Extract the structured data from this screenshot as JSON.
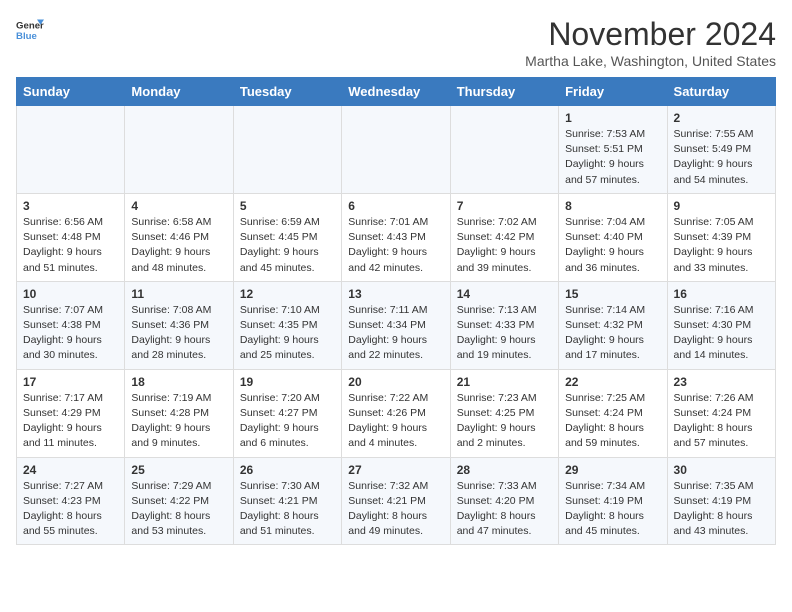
{
  "logo": {
    "line1": "General",
    "line2": "Blue"
  },
  "title": "November 2024",
  "subtitle": "Martha Lake, Washington, United States",
  "days_of_week": [
    "Sunday",
    "Monday",
    "Tuesday",
    "Wednesday",
    "Thursday",
    "Friday",
    "Saturday"
  ],
  "weeks": [
    [
      {
        "day": "",
        "text": ""
      },
      {
        "day": "",
        "text": ""
      },
      {
        "day": "",
        "text": ""
      },
      {
        "day": "",
        "text": ""
      },
      {
        "day": "",
        "text": ""
      },
      {
        "day": "1",
        "text": "Sunrise: 7:53 AM\nSunset: 5:51 PM\nDaylight: 9 hours and 57 minutes."
      },
      {
        "day": "2",
        "text": "Sunrise: 7:55 AM\nSunset: 5:49 PM\nDaylight: 9 hours and 54 minutes."
      }
    ],
    [
      {
        "day": "3",
        "text": "Sunrise: 6:56 AM\nSunset: 4:48 PM\nDaylight: 9 hours and 51 minutes."
      },
      {
        "day": "4",
        "text": "Sunrise: 6:58 AM\nSunset: 4:46 PM\nDaylight: 9 hours and 48 minutes."
      },
      {
        "day": "5",
        "text": "Sunrise: 6:59 AM\nSunset: 4:45 PM\nDaylight: 9 hours and 45 minutes."
      },
      {
        "day": "6",
        "text": "Sunrise: 7:01 AM\nSunset: 4:43 PM\nDaylight: 9 hours and 42 minutes."
      },
      {
        "day": "7",
        "text": "Sunrise: 7:02 AM\nSunset: 4:42 PM\nDaylight: 9 hours and 39 minutes."
      },
      {
        "day": "8",
        "text": "Sunrise: 7:04 AM\nSunset: 4:40 PM\nDaylight: 9 hours and 36 minutes."
      },
      {
        "day": "9",
        "text": "Sunrise: 7:05 AM\nSunset: 4:39 PM\nDaylight: 9 hours and 33 minutes."
      }
    ],
    [
      {
        "day": "10",
        "text": "Sunrise: 7:07 AM\nSunset: 4:38 PM\nDaylight: 9 hours and 30 minutes."
      },
      {
        "day": "11",
        "text": "Sunrise: 7:08 AM\nSunset: 4:36 PM\nDaylight: 9 hours and 28 minutes."
      },
      {
        "day": "12",
        "text": "Sunrise: 7:10 AM\nSunset: 4:35 PM\nDaylight: 9 hours and 25 minutes."
      },
      {
        "day": "13",
        "text": "Sunrise: 7:11 AM\nSunset: 4:34 PM\nDaylight: 9 hours and 22 minutes."
      },
      {
        "day": "14",
        "text": "Sunrise: 7:13 AM\nSunset: 4:33 PM\nDaylight: 9 hours and 19 minutes."
      },
      {
        "day": "15",
        "text": "Sunrise: 7:14 AM\nSunset: 4:32 PM\nDaylight: 9 hours and 17 minutes."
      },
      {
        "day": "16",
        "text": "Sunrise: 7:16 AM\nSunset: 4:30 PM\nDaylight: 9 hours and 14 minutes."
      }
    ],
    [
      {
        "day": "17",
        "text": "Sunrise: 7:17 AM\nSunset: 4:29 PM\nDaylight: 9 hours and 11 minutes."
      },
      {
        "day": "18",
        "text": "Sunrise: 7:19 AM\nSunset: 4:28 PM\nDaylight: 9 hours and 9 minutes."
      },
      {
        "day": "19",
        "text": "Sunrise: 7:20 AM\nSunset: 4:27 PM\nDaylight: 9 hours and 6 minutes."
      },
      {
        "day": "20",
        "text": "Sunrise: 7:22 AM\nSunset: 4:26 PM\nDaylight: 9 hours and 4 minutes."
      },
      {
        "day": "21",
        "text": "Sunrise: 7:23 AM\nSunset: 4:25 PM\nDaylight: 9 hours and 2 minutes."
      },
      {
        "day": "22",
        "text": "Sunrise: 7:25 AM\nSunset: 4:24 PM\nDaylight: 8 hours and 59 minutes."
      },
      {
        "day": "23",
        "text": "Sunrise: 7:26 AM\nSunset: 4:24 PM\nDaylight: 8 hours and 57 minutes."
      }
    ],
    [
      {
        "day": "24",
        "text": "Sunrise: 7:27 AM\nSunset: 4:23 PM\nDaylight: 8 hours and 55 minutes."
      },
      {
        "day": "25",
        "text": "Sunrise: 7:29 AM\nSunset: 4:22 PM\nDaylight: 8 hours and 53 minutes."
      },
      {
        "day": "26",
        "text": "Sunrise: 7:30 AM\nSunset: 4:21 PM\nDaylight: 8 hours and 51 minutes."
      },
      {
        "day": "27",
        "text": "Sunrise: 7:32 AM\nSunset: 4:21 PM\nDaylight: 8 hours and 49 minutes."
      },
      {
        "day": "28",
        "text": "Sunrise: 7:33 AM\nSunset: 4:20 PM\nDaylight: 8 hours and 47 minutes."
      },
      {
        "day": "29",
        "text": "Sunrise: 7:34 AM\nSunset: 4:19 PM\nDaylight: 8 hours and 45 minutes."
      },
      {
        "day": "30",
        "text": "Sunrise: 7:35 AM\nSunset: 4:19 PM\nDaylight: 8 hours and 43 minutes."
      }
    ]
  ]
}
